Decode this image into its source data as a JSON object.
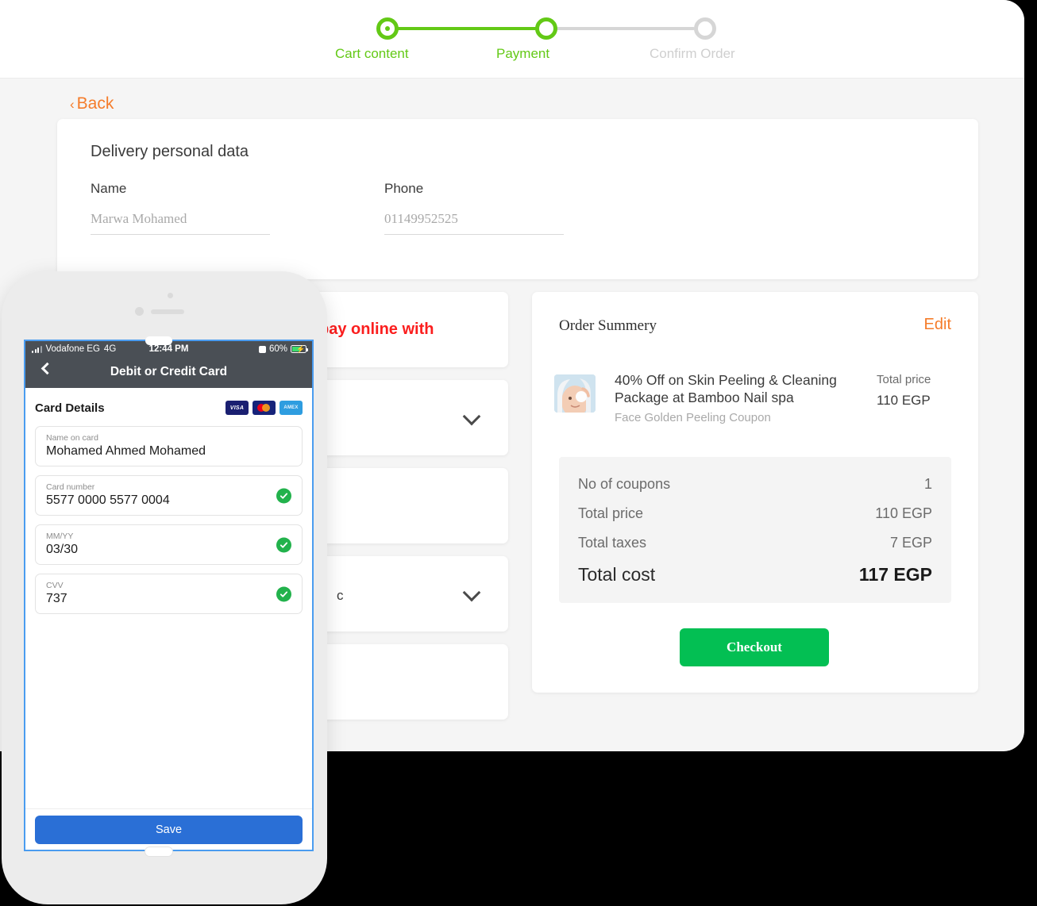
{
  "stepper": {
    "steps": [
      {
        "label": "Cart content",
        "state": "done"
      },
      {
        "label": "Payment",
        "state": "current"
      },
      {
        "label": "Confirm Order",
        "state": "todo"
      }
    ],
    "active_color": "#63c916",
    "inactive_color": "#d6d6d6"
  },
  "back": {
    "label": "Back",
    "chevron": "‹",
    "color": "#f57c2a"
  },
  "delivery": {
    "title": "Delivery personal data",
    "fields": [
      {
        "label": "Name",
        "value": "Marwa Mohamed"
      },
      {
        "label": "Phone",
        "value": "01149952525"
      }
    ]
  },
  "payment": {
    "pay_online_with": "pay online with",
    "accent_color": "#fb1e1e",
    "panels": [
      {
        "label": "pay online with",
        "has_chevron": false
      },
      {
        "label": "",
        "has_chevron": true
      },
      {
        "label": "",
        "has_chevron": false
      },
      {
        "label": "c",
        "has_chevron": true
      },
      {
        "label": "",
        "has_chevron": false
      }
    ]
  },
  "summary": {
    "title": "Order Summery",
    "edit_label": "Edit",
    "edit_color": "#f57c2a",
    "item": {
      "title": "40% Off on Skin Peeling & Cleaning Package at Bamboo Nail spa",
      "subtitle": "Face Golden Peeling Coupon",
      "price_label": "Total price",
      "price_value": "110 EGP"
    },
    "totals": [
      {
        "key": "No of coupons",
        "value": "1"
      },
      {
        "key": "Total price",
        "value": "110 EGP"
      },
      {
        "key": "Total taxes",
        "value": "7 EGP"
      }
    ],
    "grand": {
      "key": "Total cost",
      "value": "117 EGP"
    },
    "checkout_label": "Checkout",
    "checkout_color": "#03bf53"
  },
  "phone": {
    "statusbar": {
      "carrier": "Vodafone EG",
      "network": "4G",
      "time": "12:44 PM",
      "battery": "60%"
    },
    "navbar": {
      "title": "Debit or Credit Card"
    },
    "card_details": {
      "heading": "Card Details",
      "brands": [
        "VISA",
        "MC",
        "AMEX"
      ],
      "fields": [
        {
          "label": "Name on card",
          "value": "Mohamed Ahmed Mohamed",
          "valid": false
        },
        {
          "label": "Card number",
          "value": "5577 0000 5577 0004",
          "valid": true
        },
        {
          "label": "MM/YY",
          "value": "03/30",
          "valid": true
        },
        {
          "label": "CVV",
          "value": "737",
          "valid": true
        }
      ],
      "save_label": "Save",
      "save_color": "#2a6fd6"
    }
  }
}
